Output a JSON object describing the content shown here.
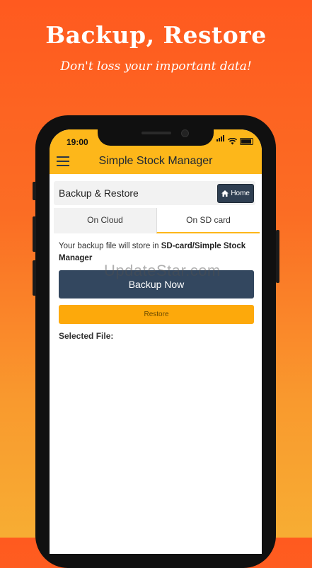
{
  "promo": {
    "title": "Backup, Restore",
    "subtitle": "Don't loss your important data!"
  },
  "status_bar": {
    "time": "19:00"
  },
  "app_bar": {
    "title": "Simple Stock Manager",
    "menu_icon": "hamburger-menu-icon"
  },
  "panel": {
    "title": "Backup & Restore",
    "home_button": "Home",
    "home_icon": "house-icon"
  },
  "tabs": [
    {
      "label": "On Cloud",
      "active": false
    },
    {
      "label": "On SD card",
      "active": true
    }
  ],
  "content": {
    "info_prefix": "Your backup file will store in ",
    "info_path": "SD-card/Simple Stock Manager",
    "backup_button": "Backup Now",
    "restore_button": "Restore",
    "selected_file_label": "Selected File:"
  },
  "watermark": "UpdateStar.com",
  "colors": {
    "accent": "#fdb71a",
    "primary_button": "#33475f",
    "restore_button": "#fda90b"
  }
}
